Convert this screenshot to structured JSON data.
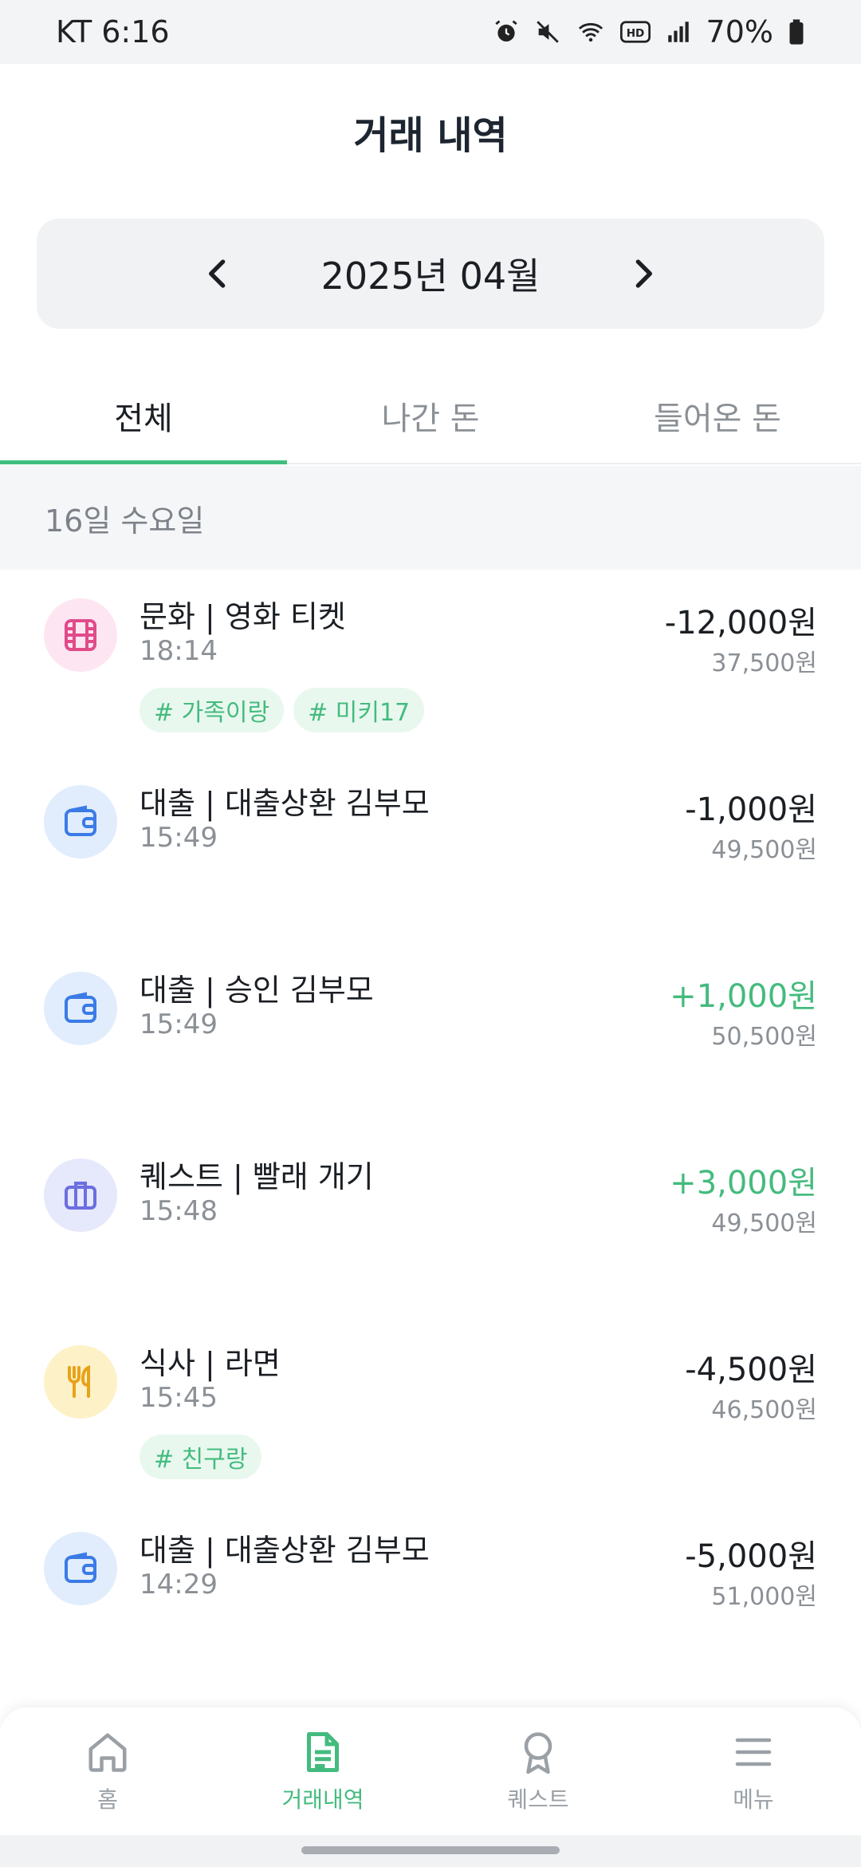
{
  "status_bar": {
    "carrier_time": "KT 6:16",
    "battery": "70%"
  },
  "header": {
    "title": "거래 내역"
  },
  "month_picker": {
    "label": "2025년 04월"
  },
  "tabs": [
    {
      "label": "전체",
      "active": true
    },
    {
      "label": "나간 돈",
      "active": false
    },
    {
      "label": "들어온 돈",
      "active": false
    }
  ],
  "day_header": "16일 수요일",
  "transactions": [
    {
      "icon": "film-icon",
      "title": "문화 | 영화 티켓",
      "time": "18:14",
      "amount": "-12,000원",
      "balance": "37,500원",
      "tags": [
        "# 가족이랑",
        "# 미키17"
      ]
    },
    {
      "icon": "wallet-icon",
      "title": "대출 | 대출상환 김부모",
      "time": "15:49",
      "amount": "-1,000원",
      "balance": "49,500원",
      "tags": []
    },
    {
      "icon": "wallet-icon",
      "title": "대출 | 승인 김부모",
      "time": "15:49",
      "amount": "+1,000원",
      "balance": "50,500원",
      "tags": []
    },
    {
      "icon": "briefcase-icon",
      "title": "퀘스트 | 빨래 개기",
      "time": "15:48",
      "amount": "+3,000원",
      "balance": "49,500원",
      "tags": []
    },
    {
      "icon": "utensils-icon",
      "title": "식사 | 라면",
      "time": "15:45",
      "amount": "-4,500원",
      "balance": "46,500원",
      "tags": [
        "# 친구랑"
      ]
    },
    {
      "icon": "wallet-icon",
      "title": "대출 | 대출상환 김부모",
      "time": "14:29",
      "amount": "-5,000원",
      "balance": "51,000원",
      "tags": []
    }
  ],
  "bottom_nav": [
    {
      "label": "홈",
      "icon": "home-icon",
      "active": false
    },
    {
      "label": "거래내역",
      "icon": "document-icon",
      "active": true
    },
    {
      "label": "퀘스트",
      "icon": "award-icon",
      "active": false
    },
    {
      "label": "메뉴",
      "icon": "menu-icon",
      "active": false
    }
  ],
  "colors": {
    "accent_green": "#44bb7e",
    "film_bg": "#fde6f1",
    "film_fg": "#e14b8a",
    "wallet_bg": "#e1edfd",
    "wallet_fg": "#3b7be6",
    "briefcase_bg": "#e6e8fb",
    "briefcase_fg": "#6b6fe0",
    "utensils_bg": "#fdf1c7",
    "utensils_fg": "#e8a21a"
  }
}
